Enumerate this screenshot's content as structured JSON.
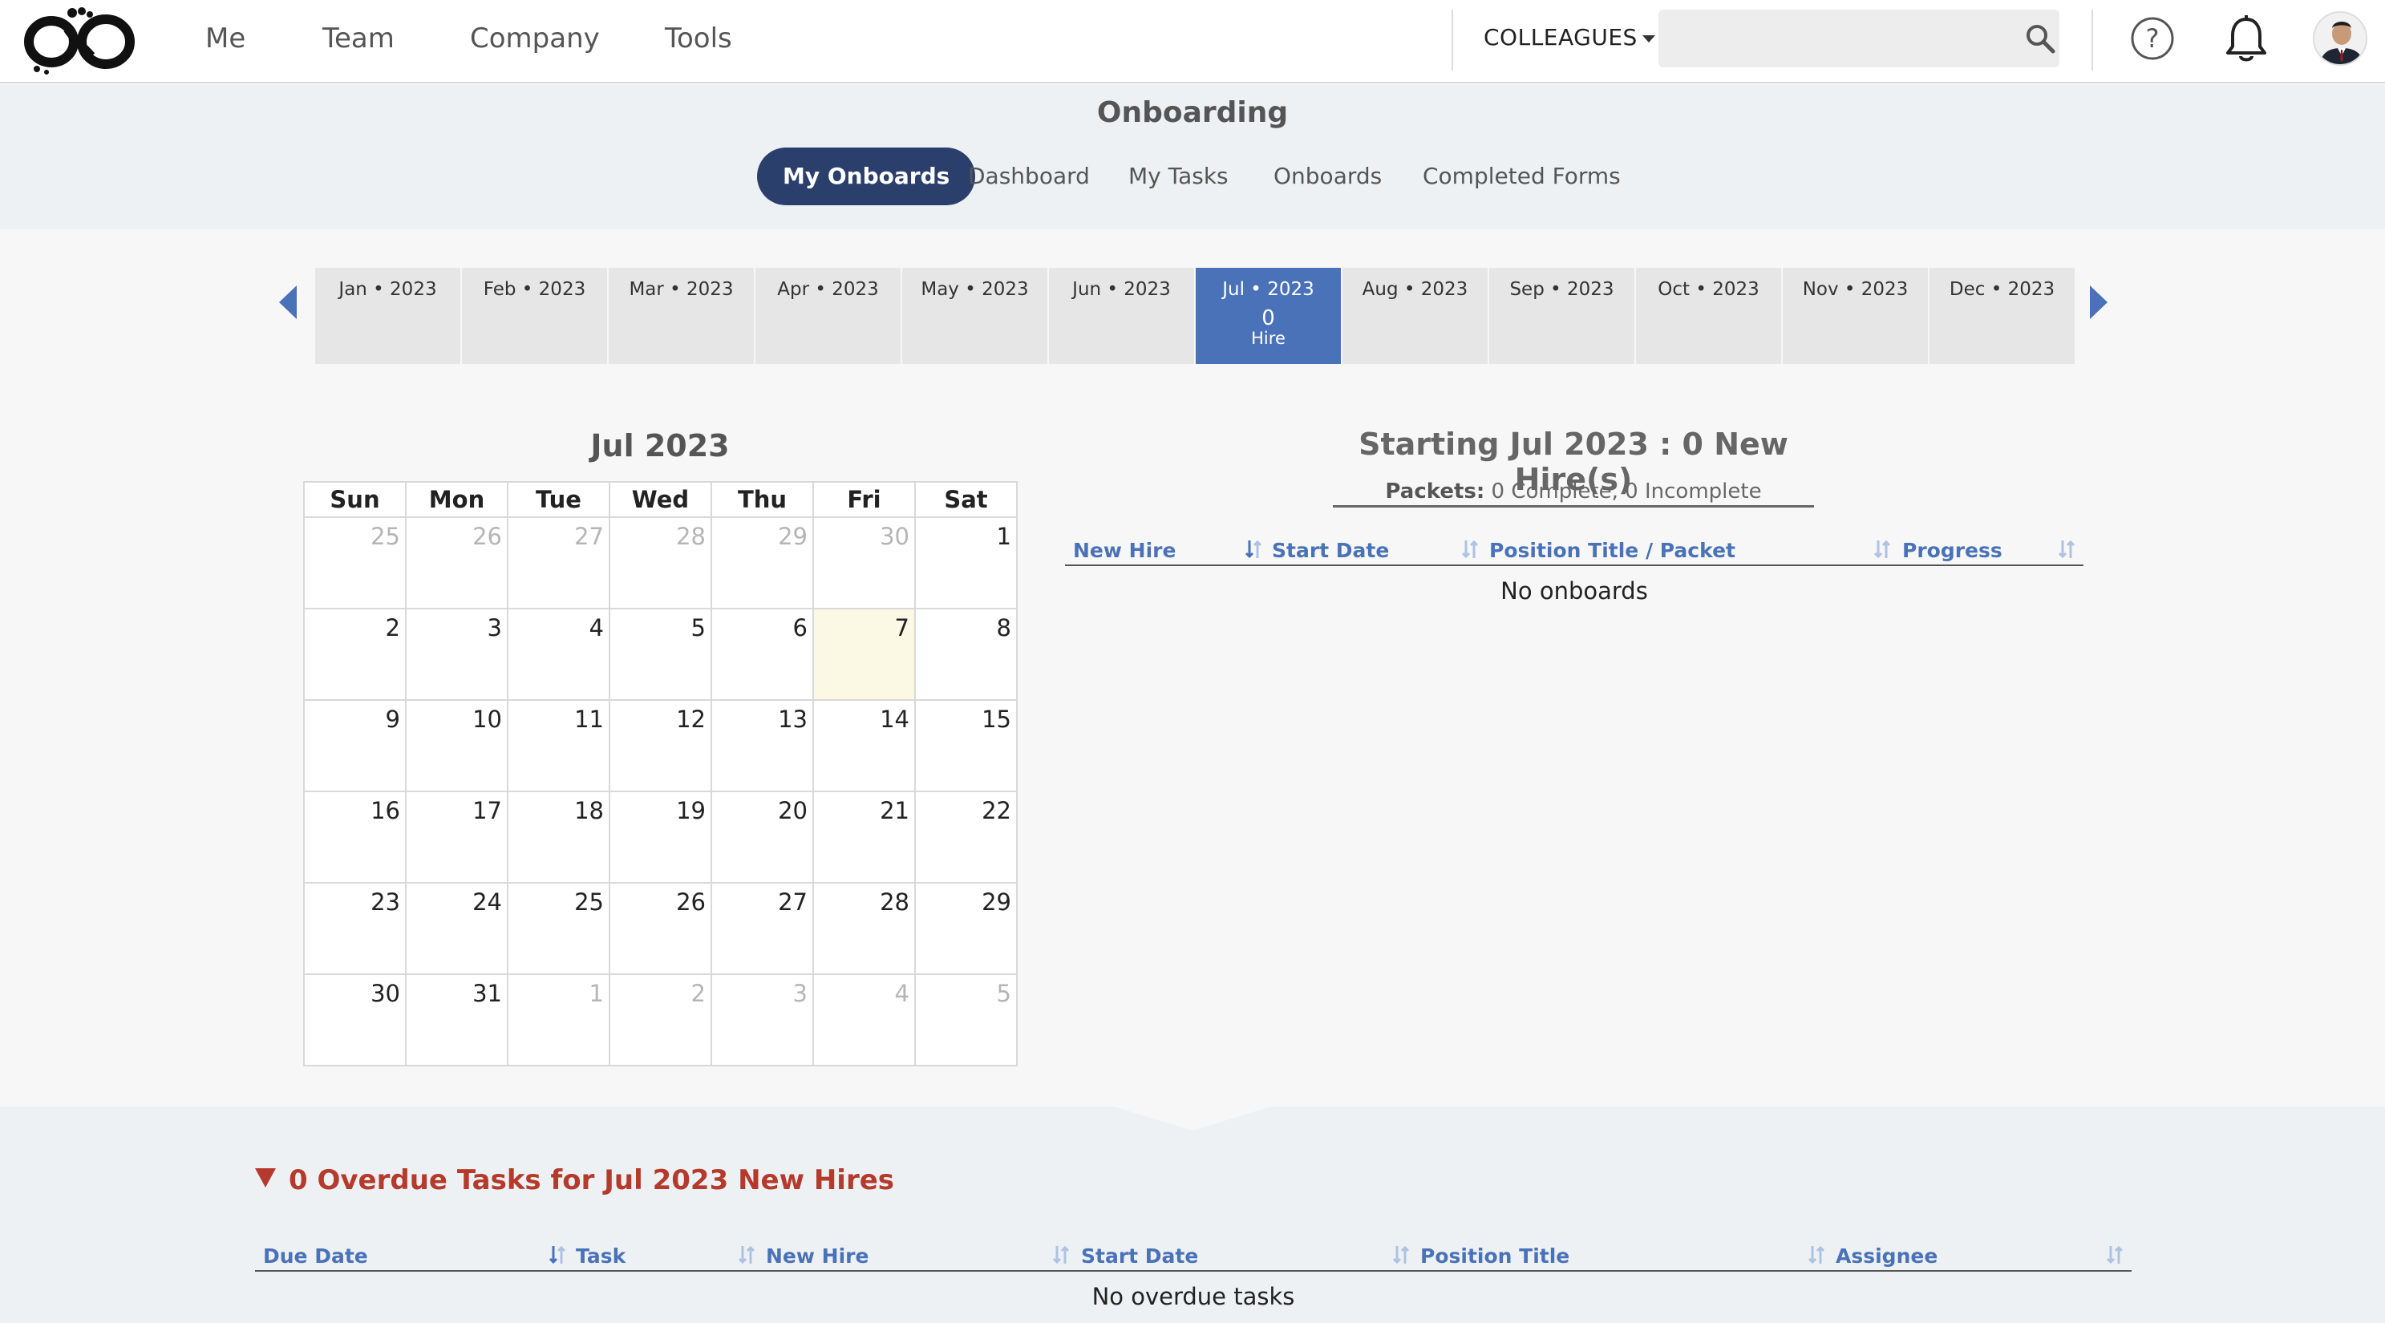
{
  "nav": {
    "items": [
      "Me",
      "Team",
      "Company",
      "Tools"
    ],
    "colleagues_label": "COLLEAGUES",
    "search_placeholder": ""
  },
  "page": {
    "title": "Onboarding",
    "tabs": [
      "My Onboards",
      "Dashboard",
      "My Tasks",
      "Onboards",
      "Completed Forms"
    ],
    "active_tab": "My Onboards"
  },
  "months": [
    {
      "label": "Jan • 2023"
    },
    {
      "label": "Feb • 2023"
    },
    {
      "label": "Mar • 2023"
    },
    {
      "label": "Apr • 2023"
    },
    {
      "label": "May • 2023"
    },
    {
      "label": "Jun • 2023"
    },
    {
      "label": "Jul • 2023",
      "count": "0",
      "sub": "Hire"
    },
    {
      "label": "Aug • 2023"
    },
    {
      "label": "Sep • 2023"
    },
    {
      "label": "Oct • 2023"
    },
    {
      "label": "Nov • 2023"
    },
    {
      "label": "Dec • 2023"
    }
  ],
  "calendar": {
    "title": "Jul 2023",
    "weekdays": [
      "Sun",
      "Mon",
      "Tue",
      "Wed",
      "Thu",
      "Fri",
      "Sat"
    ],
    "weeks": [
      [
        "25",
        "26",
        "27",
        "28",
        "29",
        "30",
        "1"
      ],
      [
        "2",
        "3",
        "4",
        "5",
        "6",
        "7",
        "8"
      ],
      [
        "9",
        "10",
        "11",
        "12",
        "13",
        "14",
        "15"
      ],
      [
        "16",
        "17",
        "18",
        "19",
        "20",
        "21",
        "22"
      ],
      [
        "23",
        "24",
        "25",
        "26",
        "27",
        "28",
        "29"
      ],
      [
        "30",
        "31",
        "1",
        "2",
        "3",
        "4",
        "5"
      ]
    ],
    "today": "7"
  },
  "onboards": {
    "title": "Starting Jul 2023 : 0 New Hire(s)",
    "packets_label": "Packets:",
    "packets_value": "0 Complete, 0 Incomplete",
    "columns": [
      "New Hire",
      "Start Date",
      "Position Title / Packet",
      "Progress"
    ],
    "empty_text": "No onboards"
  },
  "overdue": {
    "title": "0 Overdue Tasks for Jul 2023 New Hires",
    "columns": [
      "Due Date",
      "Task",
      "New Hire",
      "Start Date",
      "Position Title",
      "Assignee"
    ],
    "empty_text": "No overdue tasks"
  },
  "colors": {
    "accent": "#4a72b8",
    "active_tab_bg": "#2a3f6b",
    "overdue": "#b53a2c",
    "today_highlight": "#fbf8e4"
  }
}
